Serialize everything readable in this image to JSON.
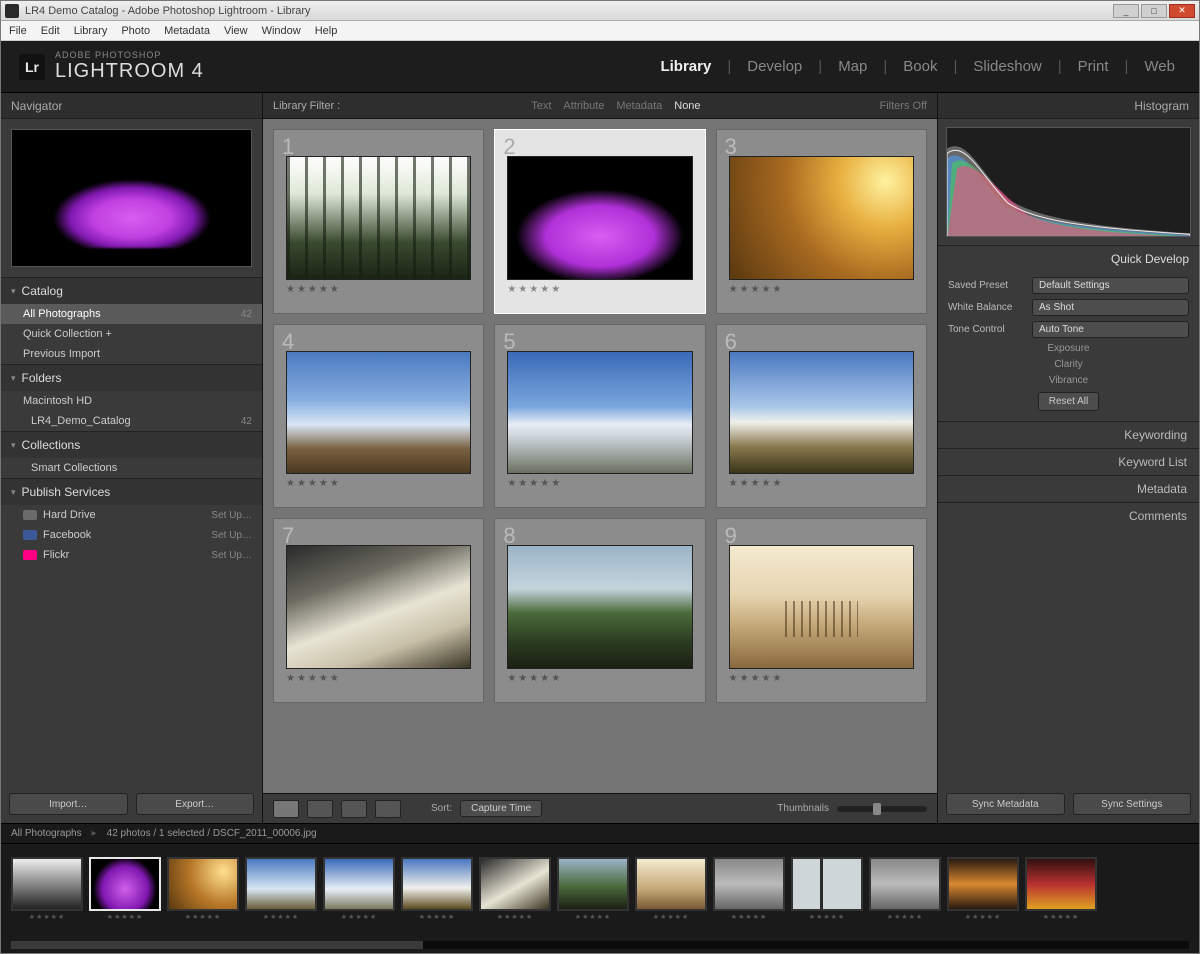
{
  "window": {
    "title": "LR4 Demo Catalog - Adobe Photoshop Lightroom - Library",
    "buttons": {
      "min": "_",
      "max": "□",
      "close": "✕"
    }
  },
  "menubar": [
    "File",
    "Edit",
    "Library",
    "Photo",
    "Metadata",
    "View",
    "Window",
    "Help"
  ],
  "branding": {
    "logo": "Lr",
    "overline": "ADOBE PHOTOSHOP",
    "product": "LIGHTROOM 4"
  },
  "modules": [
    "Library",
    "Develop",
    "Map",
    "Book",
    "Slideshow",
    "Print",
    "Web"
  ],
  "active_module": "Library",
  "left": {
    "navigator": "Navigator",
    "catalog": {
      "title": "Catalog",
      "items": [
        {
          "label": "All Photographs",
          "count": "42",
          "selected": true
        },
        {
          "label": "Quick Collection +",
          "count": ""
        },
        {
          "label": "Previous Import",
          "count": ""
        }
      ]
    },
    "folders": {
      "title": "Folders",
      "volume": "Macintosh HD",
      "items": [
        {
          "label": "LR4_Demo_Catalog",
          "count": "42"
        }
      ]
    },
    "collections": {
      "title": "Collections",
      "items": [
        {
          "label": "Smart Collections",
          "count": ""
        }
      ]
    },
    "publish": {
      "title": "Publish Services",
      "services": [
        {
          "label": "Hard Drive",
          "color": "#6a6a6a",
          "action": "Set Up…"
        },
        {
          "label": "Facebook",
          "color": "#3b5998",
          "action": "Set Up…"
        },
        {
          "label": "Flickr",
          "color": "#ff0084",
          "action": "Set Up…"
        }
      ]
    },
    "buttons": {
      "import": "Import…",
      "export": "Export…"
    }
  },
  "center": {
    "source": "Library Filter :",
    "filters": [
      "Text",
      "Attribute",
      "Metadata",
      "None"
    ],
    "active_filter": "None",
    "filters_off": "Filters Off",
    "cells": [
      1,
      2,
      3,
      4,
      5,
      6,
      7,
      8,
      9
    ],
    "selected_index": 2,
    "stars_placeholder": "★★★★★",
    "sort_label": "Sort:",
    "sort_value": "Capture Time",
    "thumbnails_label": "Thumbnails"
  },
  "right": {
    "histogram": "Histogram",
    "quick": {
      "title": "Quick Develop",
      "preset_label": "Saved Preset",
      "preset_value": "Default Settings",
      "wb_label": "White Balance",
      "wb_value": "As Shot",
      "tone_label": "Tone Control",
      "tone_value": "Auto Tone",
      "exposure": "Exposure",
      "clarity": "Clarity",
      "vibrance": "Vibrance",
      "reset": "Reset All"
    },
    "panels": [
      "Keywording",
      "Keyword List",
      "Metadata",
      "Comments"
    ],
    "buttons": {
      "sync": "Sync Metadata",
      "sync2": "Sync Settings"
    }
  },
  "filmstrip": {
    "crumb": "All Photographs",
    "status": "42 photos / 1 selected / DSCF_2011_00006.jpg",
    "thumbs": [
      "bw",
      "flower",
      "sun",
      "sky",
      "sky2",
      "sky3",
      "storm",
      "hills",
      "sepia",
      "misc",
      "win",
      "misc",
      "orange",
      "red"
    ],
    "selected": 1
  }
}
